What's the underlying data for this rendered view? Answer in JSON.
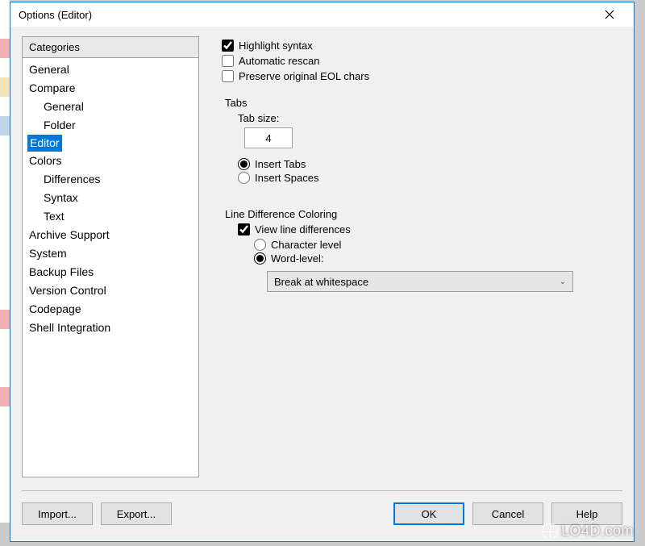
{
  "window": {
    "title": "Options (Editor)"
  },
  "categories": {
    "header": "Categories",
    "items": [
      {
        "label": "General",
        "indent": false
      },
      {
        "label": "Compare",
        "indent": false
      },
      {
        "label": "General",
        "indent": true
      },
      {
        "label": "Folder",
        "indent": true
      },
      {
        "label": "Editor",
        "indent": false,
        "selected": true
      },
      {
        "label": "Colors",
        "indent": false
      },
      {
        "label": "Differences",
        "indent": true
      },
      {
        "label": "Syntax",
        "indent": true
      },
      {
        "label": "Text",
        "indent": true
      },
      {
        "label": "Archive Support",
        "indent": false
      },
      {
        "label": "System",
        "indent": false
      },
      {
        "label": "Backup Files",
        "indent": false
      },
      {
        "label": "Version Control",
        "indent": false
      },
      {
        "label": "Codepage",
        "indent": false
      },
      {
        "label": "Shell Integration",
        "indent": false
      }
    ]
  },
  "editor": {
    "highlight_syntax": {
      "label": "Highlight syntax",
      "checked": true
    },
    "automatic_rescan": {
      "label": "Automatic rescan",
      "checked": false
    },
    "preserve_eol": {
      "label": "Preserve original EOL chars",
      "checked": false
    },
    "tabs": {
      "title": "Tabs",
      "size_label": "Tab size:",
      "size_value": "4",
      "insert_tabs": {
        "label": "Insert Tabs",
        "selected": true
      },
      "insert_spaces": {
        "label": "Insert Spaces",
        "selected": false
      }
    },
    "line_diff": {
      "title": "Line Difference Coloring",
      "view": {
        "label": "View line differences",
        "checked": true
      },
      "char_level": {
        "label": "Character level",
        "selected": false
      },
      "word_level": {
        "label": "Word-level:",
        "selected": true
      },
      "break_select": "Break at whitespace"
    }
  },
  "buttons": {
    "import": "Import...",
    "export": "Export...",
    "ok": "OK",
    "cancel": "Cancel",
    "help": "Help"
  },
  "watermark": "LO4D.com"
}
